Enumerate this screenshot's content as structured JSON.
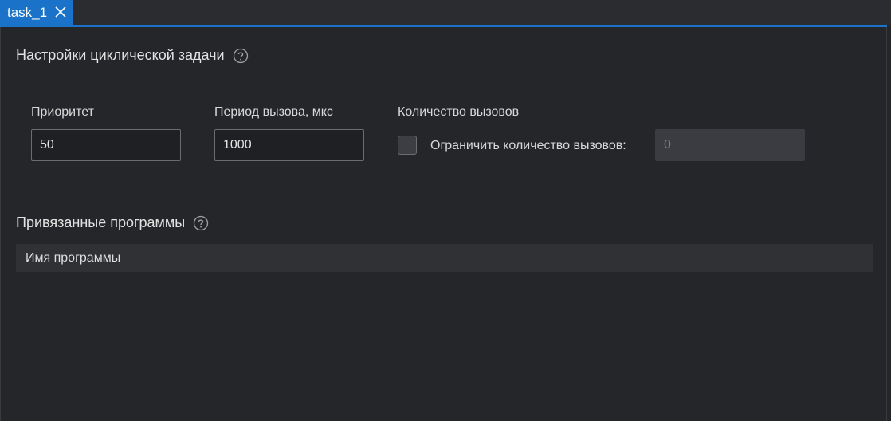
{
  "tab": {
    "label": "task_1"
  },
  "cyclic_settings": {
    "title": "Настройки циклической задачи",
    "priority": {
      "label": "Приоритет",
      "value": "50"
    },
    "period": {
      "label": "Период вызова, мкс",
      "value": "1000"
    },
    "calls": {
      "label": "Количество вызовов",
      "limit_label": "Ограничить количество вызовов:",
      "limit_checked": false,
      "limit_value": "0"
    }
  },
  "linked_programs": {
    "title": "Привязанные программы",
    "columns": [
      "Имя программы"
    ]
  },
  "colors": {
    "accent": "#1a73c8",
    "background": "#25262a"
  }
}
